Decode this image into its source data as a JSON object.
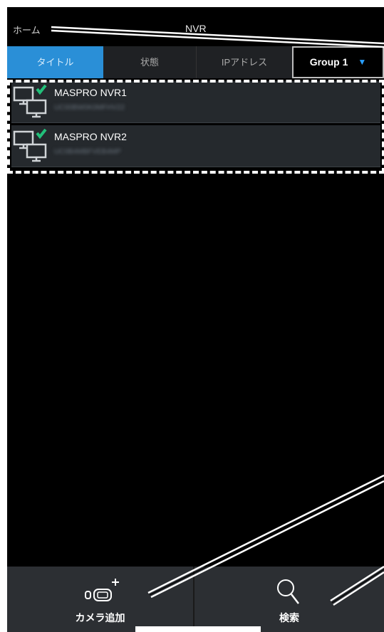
{
  "header": {
    "home_label": "ホーム",
    "title": "NVR"
  },
  "tabs": {
    "title": "タイトル",
    "status": "状態",
    "ip": "IPアドレス",
    "group_selected": "Group 1"
  },
  "devices": [
    {
      "name": "MASPRO NVR1",
      "id": "UC00BW0K0MFHV22"
    },
    {
      "name": "MASPRO NVR2",
      "id": "UC0B4MBFVEB4MP"
    }
  ],
  "bottom": {
    "add_camera_label": "カメラ追加",
    "search_label": "検索"
  },
  "colors": {
    "accent": "#2a8fd7",
    "check": "#22c07a",
    "bar": "#2c2f33"
  },
  "icons": [
    "monitor-pair-icon",
    "check-badge-icon",
    "dropdown-arrow-icon",
    "add-camera-icon",
    "search-icon"
  ]
}
